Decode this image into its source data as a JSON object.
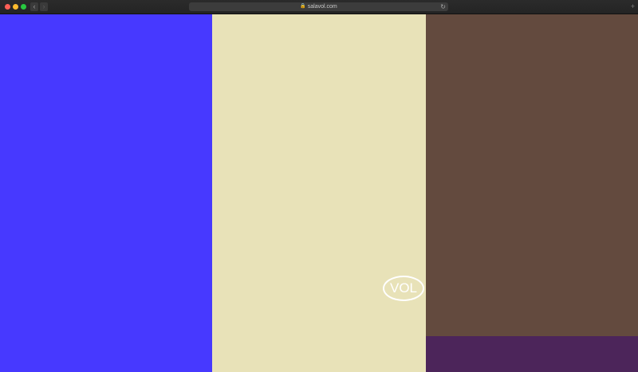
{
  "browser": {
    "url": "salavol.com",
    "back_icon": "chevron-left-icon",
    "forward_icon": "chevron-right-icon",
    "lock_icon": "lock-icon",
    "reload_icon": "reload-icon",
    "new_tab_icon": "plus-icon"
  },
  "page": {
    "logo_text": "VOL",
    "colors": {
      "left": "#4739ff",
      "middle": "#e8e2b8",
      "right": "#634a3e",
      "bottom_strip": "#4c255a"
    }
  }
}
